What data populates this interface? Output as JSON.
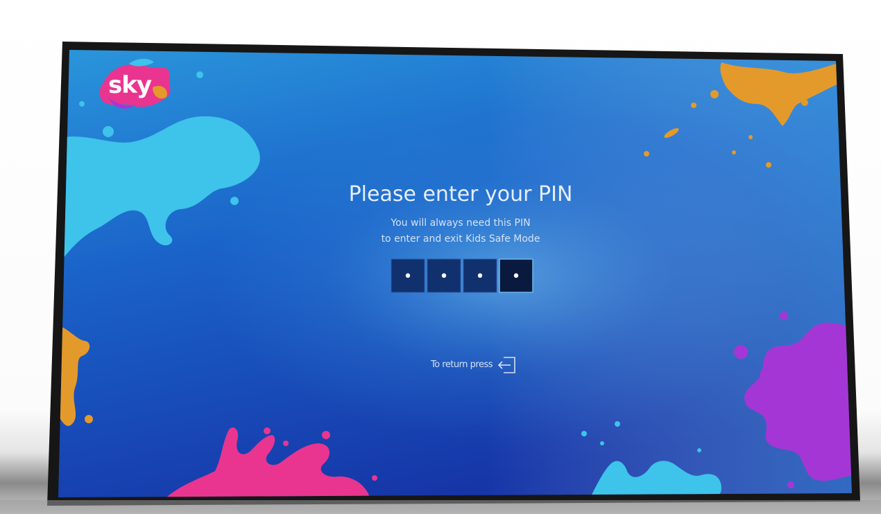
{
  "brand": {
    "logo_text": "sky"
  },
  "pin_screen": {
    "title": "Please enter your PIN",
    "subtitle_line1": "You will always need this PIN",
    "subtitle_line2": "to enter and exit Kids Safe Mode",
    "pin_digits": [
      {
        "mask": "•",
        "state": "filled"
      },
      {
        "mask": "•",
        "state": "filled"
      },
      {
        "mask": "•",
        "state": "filled"
      },
      {
        "mask": "•",
        "state": "focused"
      }
    ],
    "return_hint": "To return press",
    "return_icon": "back-exit-icon"
  },
  "colors": {
    "screen_top": "#1f86d6",
    "screen_bottom": "#1236a8",
    "pin_box": "#0f2a66",
    "pin_box_focused": "#0a1a3f",
    "splash_cyan": "#3ec3ea",
    "splash_orange": "#e49a2a",
    "splash_pink": "#e9358f",
    "splash_purple": "#a536d6"
  }
}
